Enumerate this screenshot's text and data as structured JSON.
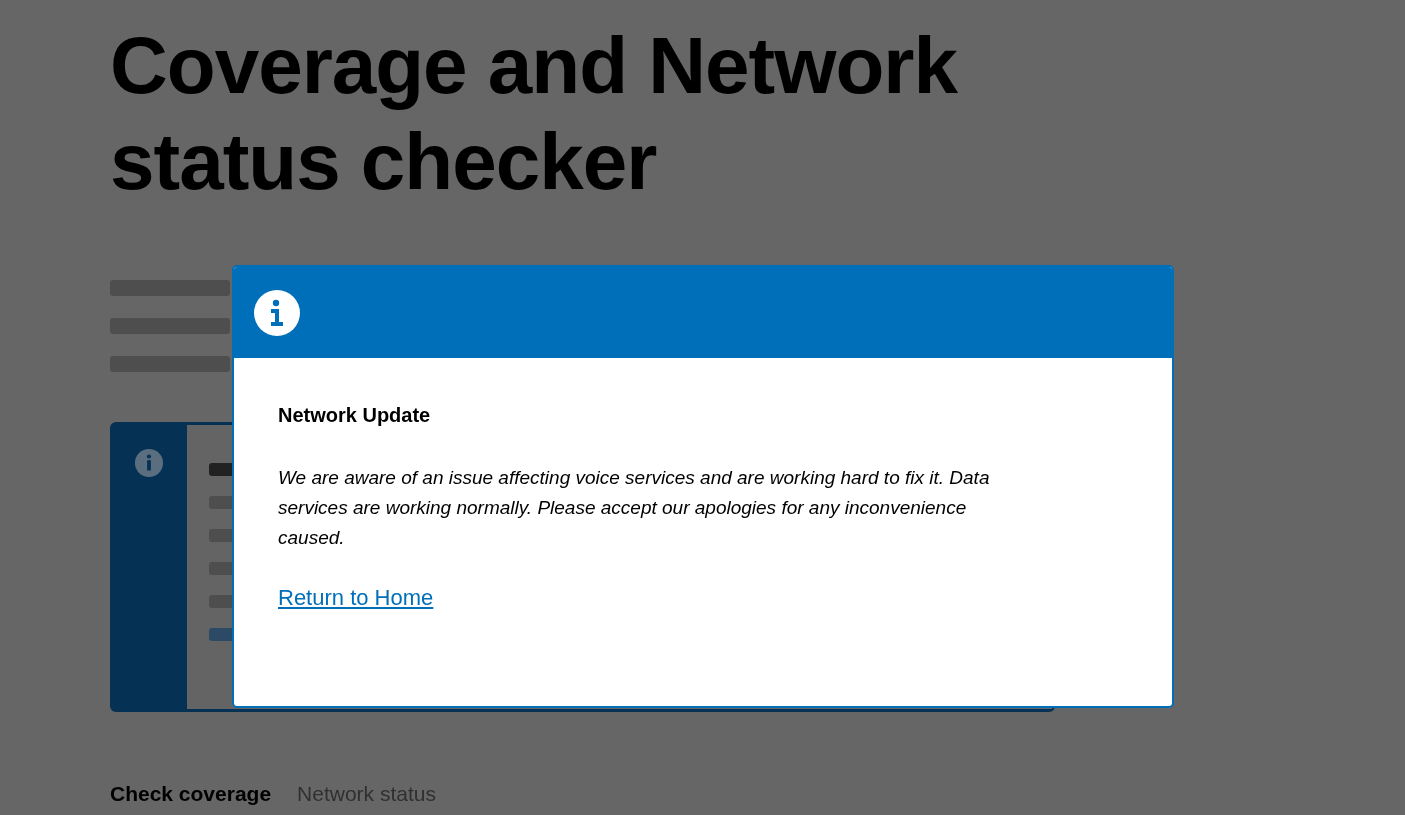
{
  "page": {
    "heading": "Coverage and Network status checker",
    "tabs": [
      {
        "label": "Check coverage",
        "selected": true
      },
      {
        "label": "Network status",
        "selected": false
      }
    ]
  },
  "modal": {
    "title": "Network Update",
    "message": "We are aware of an issue affecting voice services and are working hard to fix it. Data services are working normally. Please accept our apologies for any inconvenience caused.",
    "link": "Return to Home"
  }
}
